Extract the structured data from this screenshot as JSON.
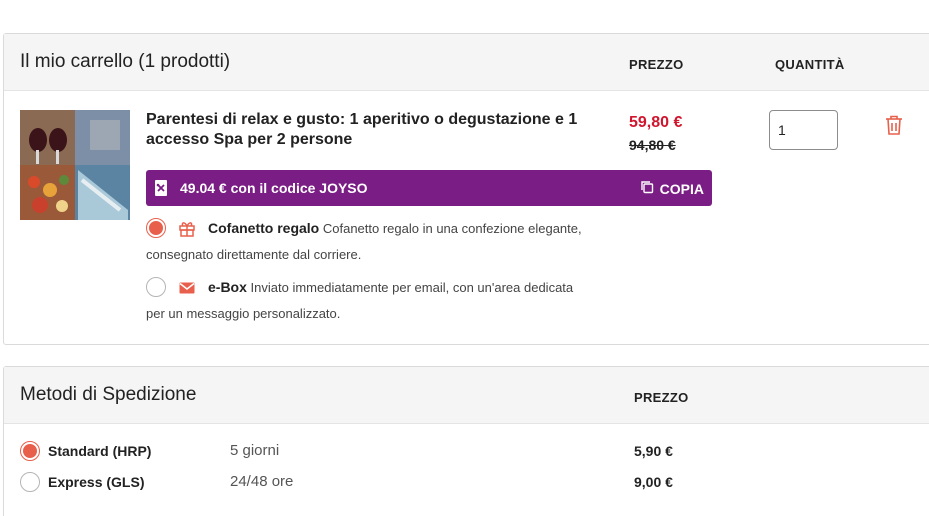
{
  "cart": {
    "title": "Il mio carrello (1 prodotti)",
    "col_price": "PREZZO",
    "col_qty": "QUANTITÀ",
    "product": {
      "title": "Parentesi di relax e gusto: 1 aperitivo o degusta­zione e 1 accesso Spa per 2 persone",
      "price_new": "59,80 €",
      "price_old": "94,80 €",
      "quantity": "1"
    },
    "promo": {
      "text": "49.04 € con il codice JOYSO",
      "copy_label": "COPIA"
    },
    "options": [
      {
        "name": "Cofanetto regalo",
        "desc": "Cofanetto regalo in una confezione elegante, consegnato direttamente dal corriere.",
        "selected": true,
        "icon": "gift-icon"
      },
      {
        "name": "e-Box",
        "desc": "Inviato immediatamente per email, con un'area dedicata per un messaggio personalizzato.",
        "selected": false,
        "icon": "envelope-icon"
      }
    ]
  },
  "shipping": {
    "title": "Metodi di Spedizione",
    "col_price": "PREZZO",
    "methods": [
      {
        "name": "Standard (HRP)",
        "time": "5 giorni",
        "price": "5,90 €",
        "selected": true
      },
      {
        "name": "Express (GLS)",
        "time": "24/48 ore",
        "price": "9,00 €",
        "selected": false
      }
    ]
  },
  "colors": {
    "accent": "#e8604c",
    "promo_bg": "#7a1d84",
    "price_red": "#d0152e"
  }
}
